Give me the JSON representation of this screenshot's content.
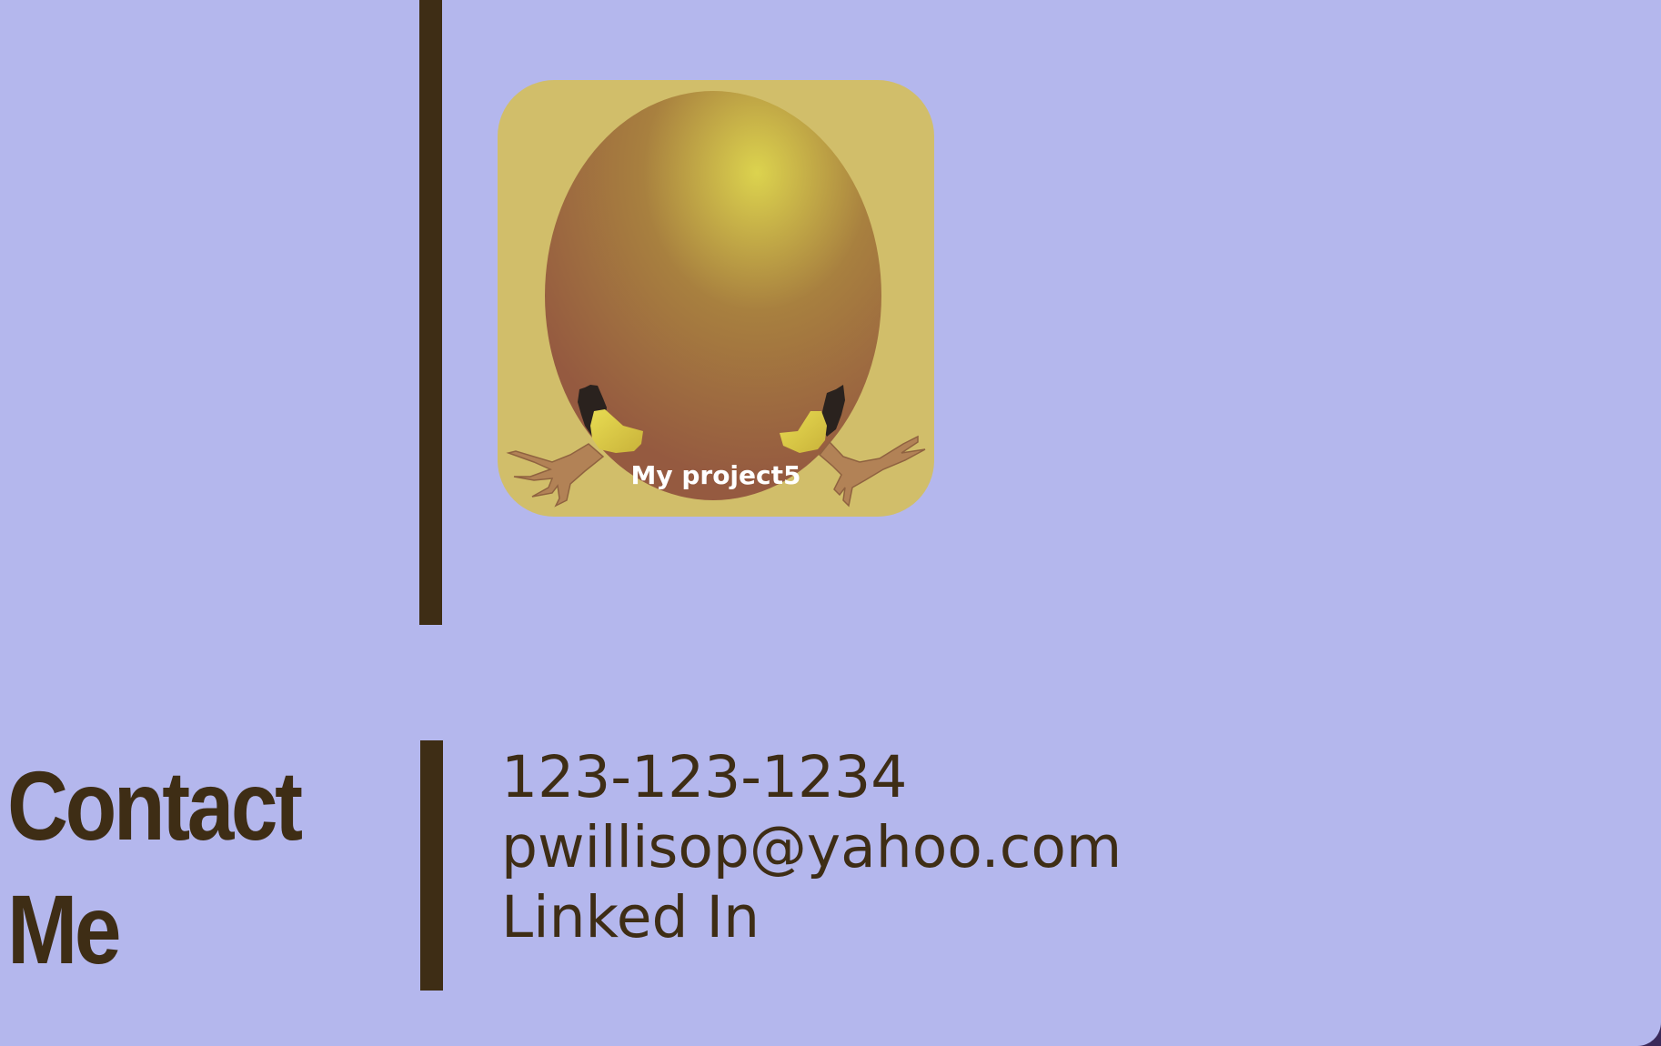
{
  "project": {
    "title": "My project5",
    "icon": "egg-hatching-icon"
  },
  "contact": {
    "heading_line1": "Contact",
    "heading_line2": "Me",
    "phone": "123-123-1234",
    "email": "pwillisop@yahoo.com",
    "linkedin": "Linked In"
  },
  "colors": {
    "background": "#b4b7ed",
    "accent": "#3e2d15",
    "card": "#d1be6a"
  }
}
